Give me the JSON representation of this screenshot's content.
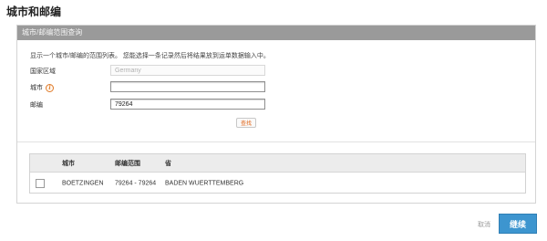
{
  "page": {
    "title": "城市和邮编"
  },
  "panel": {
    "header": "城市/邮编范围查询",
    "instructions": "显示一个城市/邮编的范围列表。 您能选择一条记录然后将结果放到运单数据输入中。"
  },
  "form": {
    "country": {
      "label": "国家区域",
      "value": "Germany"
    },
    "city": {
      "label": "城市",
      "value": "",
      "info_icon": "info-icon"
    },
    "postcode": {
      "label": "邮编",
      "value": "79264"
    },
    "search_label": "查找"
  },
  "results": {
    "headers": {
      "city": "城市",
      "range": "邮编范围",
      "state": "省"
    },
    "rows": [
      {
        "city": "BOETZINGEN",
        "range": "79264 - 79264",
        "state": "BADEN WUERTTEMBERG",
        "selected": false
      }
    ]
  },
  "footer": {
    "cancel_label": "取消",
    "continue_label": "继续"
  },
  "colors": {
    "primary_button": "#3d95cf",
    "search_text": "#e0661a",
    "panel_header": "#9a9a9a"
  }
}
